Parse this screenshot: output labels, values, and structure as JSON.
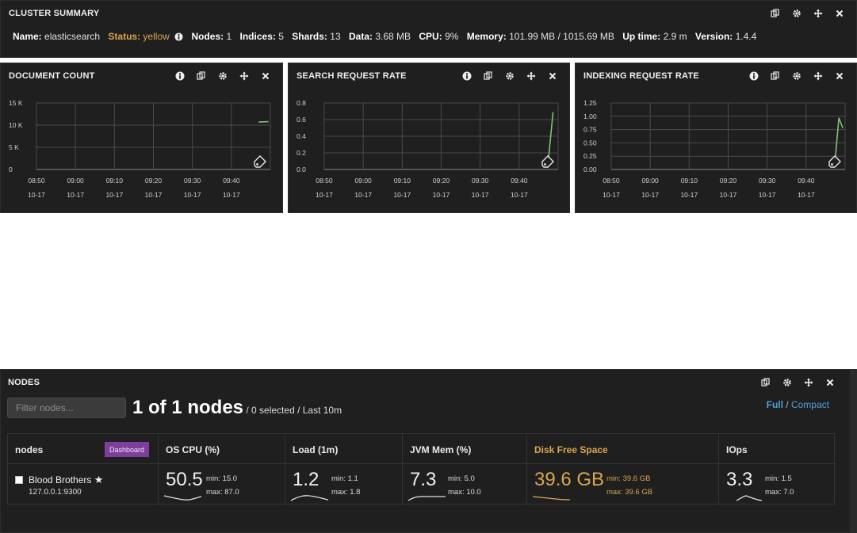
{
  "cluster_summary": {
    "title": "CLUSTER SUMMARY",
    "fields": {
      "name_label": "Name:",
      "name_value": "elasticsearch",
      "status_label": "Status:",
      "status_value": "yellow",
      "nodes_label": "Nodes:",
      "nodes_value": "1",
      "indices_label": "Indices:",
      "indices_value": "5",
      "shards_label": "Shards:",
      "shards_value": "13",
      "data_label": "Data:",
      "data_value": "3.68 MB",
      "cpu_label": "CPU:",
      "cpu_value": "9%",
      "memory_label": "Memory:",
      "memory_value": "101.99 MB / 1015.69 MB",
      "uptime_label": "Up time:",
      "uptime_value": "2.9 m",
      "version_label": "Version:",
      "version_value": "1.4.4"
    },
    "status_color": "#d8a64f"
  },
  "charts": [
    {
      "id": "document-count",
      "title": "DOCUMENT COUNT",
      "chart_data": {
        "type": "line",
        "title": "DOCUMENT COUNT",
        "x_ticks": [
          "08:50",
          "09:00",
          "09:10",
          "09:20",
          "09:30",
          "09:40"
        ],
        "x_ticks_date": "10-17",
        "y_ticks": [
          "0",
          "5 K",
          "10 K",
          "15 K"
        ],
        "ylim": [
          0,
          15000
        ],
        "xlim_minutes": [
          0,
          60
        ],
        "series": [
          {
            "x": [
              57,
              59.5
            ],
            "y": [
              10700,
              10800
            ]
          }
        ],
        "line_color": "#7cc576"
      }
    },
    {
      "id": "search-request-rate",
      "title": "SEARCH REQUEST RATE",
      "chart_data": {
        "type": "line",
        "title": "SEARCH REQUEST RATE",
        "x_ticks": [
          "08:50",
          "09:00",
          "09:10",
          "09:20",
          "09:30",
          "09:40"
        ],
        "x_ticks_date": "10-17",
        "y_ticks": [
          "0.0",
          "0.2",
          "0.4",
          "0.6",
          "0.8"
        ],
        "ylim": [
          0,
          0.8
        ],
        "xlim_minutes": [
          0,
          60
        ],
        "series": [
          {
            "x": [
              57.3,
              58.7
            ],
            "y": [
              0.02,
              0.69
            ]
          }
        ],
        "line_color": "#7cc576"
      }
    },
    {
      "id": "indexing-request-rate",
      "title": "INDEXING REQUEST RATE",
      "chart_data": {
        "type": "line",
        "title": "INDEXING REQUEST RATE",
        "x_ticks": [
          "08:50",
          "09:00",
          "09:10",
          "09:20",
          "09:30",
          "09:40"
        ],
        "x_ticks_date": "10-17",
        "y_ticks": [
          "0.00",
          "0.25",
          "0.50",
          "0.75",
          "1.00",
          "1.25"
        ],
        "ylim": [
          0,
          1.25
        ],
        "xlim_minutes": [
          0,
          60
        ],
        "series": [
          {
            "x": [
              57.3,
              58.4,
              59.4
            ],
            "y": [
              0.05,
              0.97,
              0.78
            ]
          }
        ],
        "line_color": "#7cc576"
      }
    }
  ],
  "nodes_panel": {
    "title": "NODES",
    "filter_placeholder": "Filter nodes...",
    "count_big": "1 of 1 nodes",
    "count_small": " / 0 selected / Last 10m",
    "view_full": "Full",
    "view_sep": " / ",
    "view_compact": "Compact",
    "columns": {
      "nodes": "nodes",
      "dashboard": "Dashboard",
      "os_cpu": "OS CPU (%)",
      "load": "Load (1m)",
      "jvm_mem": "JVM Mem (%)",
      "disk": "Disk Free Space",
      "iops": "IOps"
    },
    "node": {
      "name": "Blood Brothers",
      "star": "★",
      "address": "127.0.0.1:9300",
      "os_cpu": {
        "value": "50.5",
        "min": "min: 15.0",
        "max": "max: 87.0"
      },
      "load": {
        "value": "1.2",
        "min": "min: 1.1",
        "max": "max: 1.8"
      },
      "jvm_mem": {
        "value": "7.3",
        "min": "min: 5.0",
        "max": "max: 10.0"
      },
      "disk": {
        "value": "39.6 GB",
        "min": "min: 39.6 GB",
        "max": "max: 39.6 GB"
      },
      "iops": {
        "value": "3.3",
        "min": "min: 1.5",
        "max": "max: 7.0"
      }
    },
    "accent_gold": "#d8a64f",
    "dashboard_color": "#7d3f9b"
  }
}
